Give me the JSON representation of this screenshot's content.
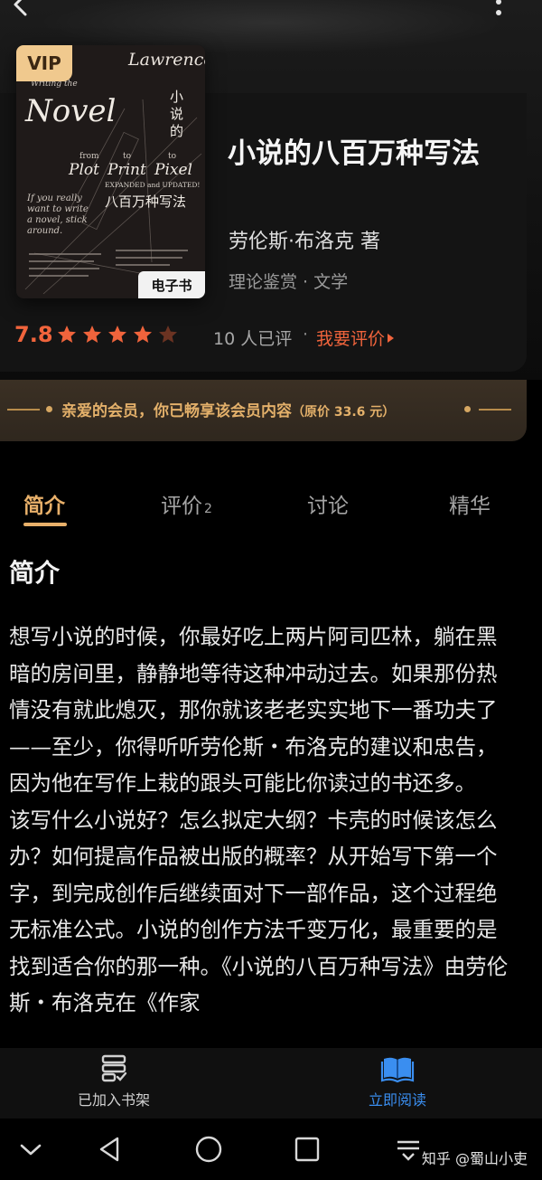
{
  "app": {
    "colors": {
      "accent": "#e8b06a",
      "score": "#f0643c",
      "link_blue": "#3a8ef0"
    }
  },
  "header": {
    "back_icon": "chevron-left-icon",
    "more_icon": "more-vertical-icon"
  },
  "book": {
    "cover": {
      "vip_badge": "VIP",
      "author_en": "Lawrence Block",
      "line1": "Writing the",
      "big_title": "Novel",
      "line2a": "from",
      "line2b": "to",
      "line2c": "to",
      "plot": "Plot",
      "print": "Print",
      "pixel": "Pixel",
      "edition": "EXPANDED and UPDATED!",
      "cn_title_vertical": [
        "小",
        "说",
        "的"
      ],
      "cn_title_line": "八百万种写法",
      "blurb": [
        "If you really",
        "want to write",
        "a novel, stick",
        "around."
      ],
      "ebook_badge": "电子书"
    },
    "title": "小说的八百万种写法",
    "author": "劳伦斯·布洛克 著",
    "tags": "理论鉴赏 · 文学",
    "rating": {
      "score": "7.8",
      "stars": 4.5,
      "count": "10 人已评",
      "separator": "·",
      "rate_link": "我要评价"
    }
  },
  "membership": {
    "text": "亲爱的会员，你已畅享该会员内容",
    "price": "（原价 33.6 元）"
  },
  "tabs": [
    {
      "label": "简介",
      "sub": ""
    },
    {
      "label": "评价",
      "sub": "2"
    },
    {
      "label": "讨论",
      "sub": ""
    },
    {
      "label": "精华",
      "sub": ""
    }
  ],
  "intro": {
    "heading": "简介",
    "paragraphs": [
      "想写小说的时候，你最好吃上两片阿司匹林，躺在黑暗的房间里，静静地等待这种冲动过去。如果那份热情没有就此熄灭，那你就该老老实实地下一番功夫了——至少，你得听听劳伦斯・布洛克的建议和忠告，因为他在写作上栽的跟头可能比你读过的书还多。",
      "该写什么小说好？怎么拟定大纲？卡壳的时候该怎么办？如何提高作品被出版的概率？从开始写下第一个字，到完成创作后继续面对下一部作品，这个过程绝无标准公式。小说的创作方法千变万化，最重要的是找到适合你的那一种。《小说的八百万种写法》由劳伦斯・布洛克在《作家"
    ]
  },
  "bottom_actions": {
    "shelf": {
      "label": "已加入书架",
      "icon": "bookshelf-check-icon"
    },
    "read": {
      "label": "立即阅读",
      "icon": "open-book-icon"
    }
  },
  "system_nav": {
    "buttons": [
      "chevron-down-icon",
      "back-triangle-icon",
      "home-circle-icon",
      "recents-square-icon",
      "menu-lines-icon"
    ],
    "watermark": "知乎 @蜀山小吏"
  }
}
